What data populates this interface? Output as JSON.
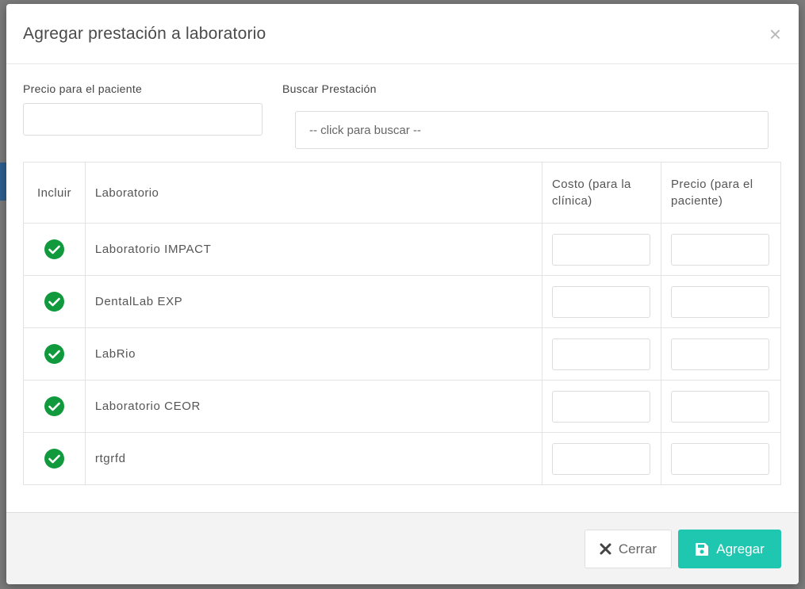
{
  "modal": {
    "title": "Agregar prestación a laboratorio",
    "close_glyph": "×"
  },
  "form": {
    "price_label": "Precio para el paciente",
    "price_value": "",
    "search_label": "Buscar Prestación",
    "search_placeholder": "-- click para buscar --"
  },
  "table": {
    "headers": {
      "include": "Incluir",
      "lab": "Laboratorio",
      "cost": "Costo (para la clínica)",
      "price": "Precio (para el paciente)"
    },
    "rows": [
      {
        "name": "Laboratorio IMPACT",
        "included": true,
        "cost": "",
        "price": ""
      },
      {
        "name": "DentalLab EXP",
        "included": true,
        "cost": "",
        "price": ""
      },
      {
        "name": "LabRio",
        "included": true,
        "cost": "",
        "price": ""
      },
      {
        "name": "Laboratorio CEOR",
        "included": true,
        "cost": "",
        "price": ""
      },
      {
        "name": "rtgrfd",
        "included": true,
        "cost": "",
        "price": ""
      }
    ]
  },
  "footer": {
    "close_label": "Cerrar",
    "add_label": "Agregar"
  },
  "icons": {
    "include": "check-circle-icon",
    "close_button": "x-icon",
    "add_button": "save-icon"
  },
  "colors": {
    "check": "#119a3d",
    "add_button": "#1fc6b0"
  }
}
